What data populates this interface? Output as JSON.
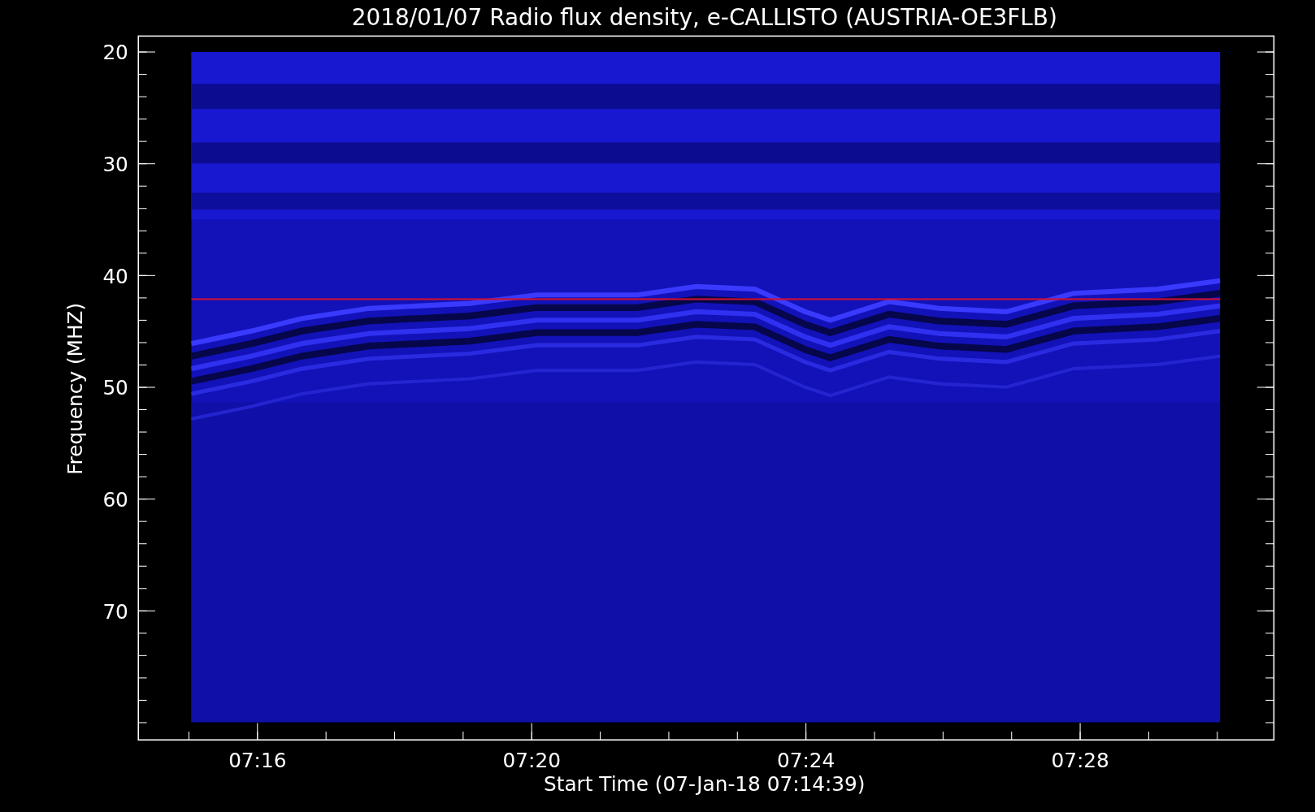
{
  "plot": {
    "title": "2018/01/07  Radio flux density, e-CALLISTO (AUSTRIA-OE3FLB)",
    "x_axis": {
      "label": "Start Time (07-Jan-18 07:14:39)",
      "ticks": [
        "07:16",
        "07:20",
        "07:24",
        "07:28"
      ]
    },
    "y_axis": {
      "label": "Frequency (MHZ)",
      "ticks": [
        "20",
        "30",
        "40",
        "50",
        "60",
        "70"
      ]
    },
    "image": {
      "kind": "spectrogram"
    }
  }
}
